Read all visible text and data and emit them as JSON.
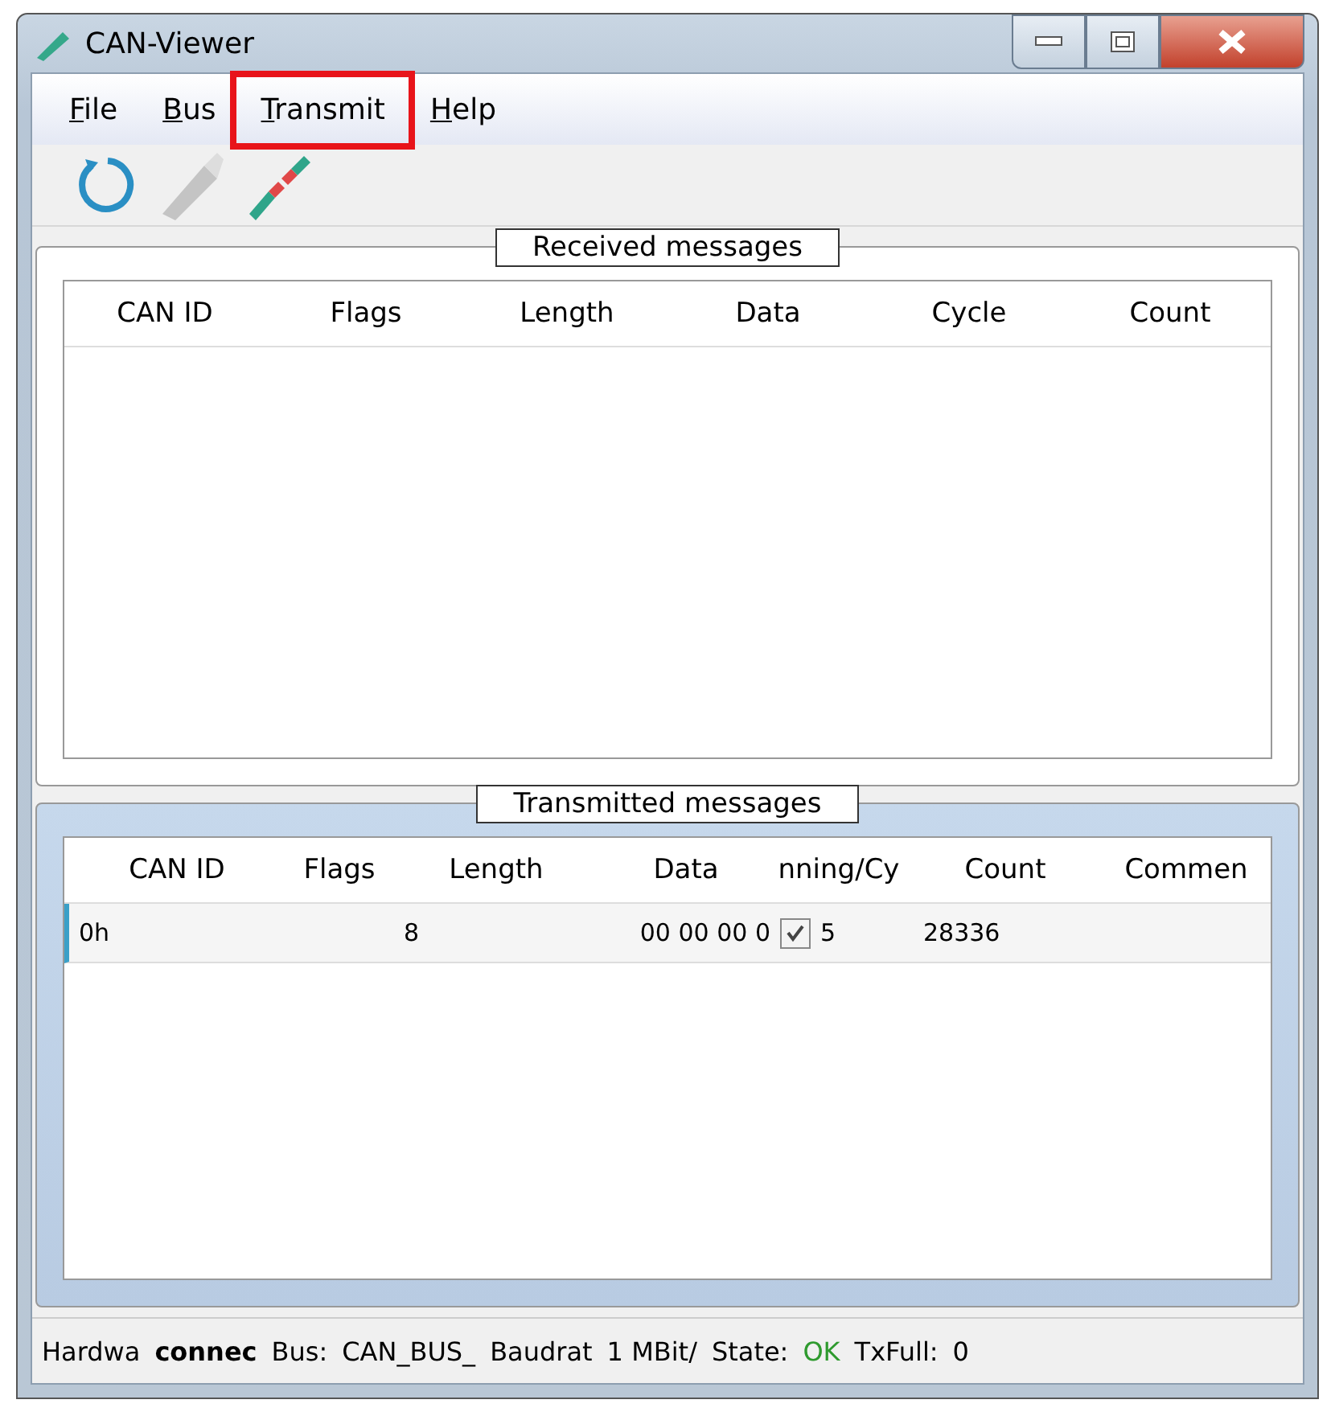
{
  "window": {
    "title": "CAN-Viewer"
  },
  "menu": [
    {
      "label": "File",
      "highlighted": false
    },
    {
      "label": "Bus",
      "highlighted": false
    },
    {
      "label": "Transmit",
      "highlighted": true
    },
    {
      "label": "Help",
      "highlighted": false
    }
  ],
  "toolbar": [
    {
      "kind": "refresh",
      "disabled": false
    },
    {
      "kind": "plug",
      "disabled": true
    },
    {
      "kind": "plug",
      "disabled": false
    }
  ],
  "received": {
    "title": "Received messages",
    "columns": [
      "CAN ID",
      "Flags",
      "Length",
      "Data",
      "Cycle",
      "Count"
    ]
  },
  "transmitted": {
    "title": "Transmitted messages",
    "columns": [
      "CAN ID",
      "Flags",
      "Length",
      "Data",
      "nning/Cy",
      "Count",
      "Commen"
    ],
    "rows": [
      {
        "can_id": "0h",
        "flags": "",
        "length": "8",
        "data": "00 00 00 0",
        "running": true,
        "cycle": "5",
        "count": "28336",
        "comment": ""
      }
    ]
  },
  "status_bar": [
    {
      "text": "Hardwa",
      "kind": "plain"
    },
    {
      "text": "connec",
      "kind": "bold"
    },
    {
      "text": "Bus:",
      "kind": "plain"
    },
    {
      "text": "CAN_BUS_",
      "kind": "plain"
    },
    {
      "text": "Baudrat",
      "kind": "plain"
    },
    {
      "text": "1 MBit/",
      "kind": "plain"
    },
    {
      "text": "State:",
      "kind": "plain"
    },
    {
      "text": "OK",
      "kind": "ok"
    },
    {
      "text": "TxFull:",
      "kind": "plain"
    },
    {
      "text": "0",
      "kind": "plain"
    }
  ]
}
